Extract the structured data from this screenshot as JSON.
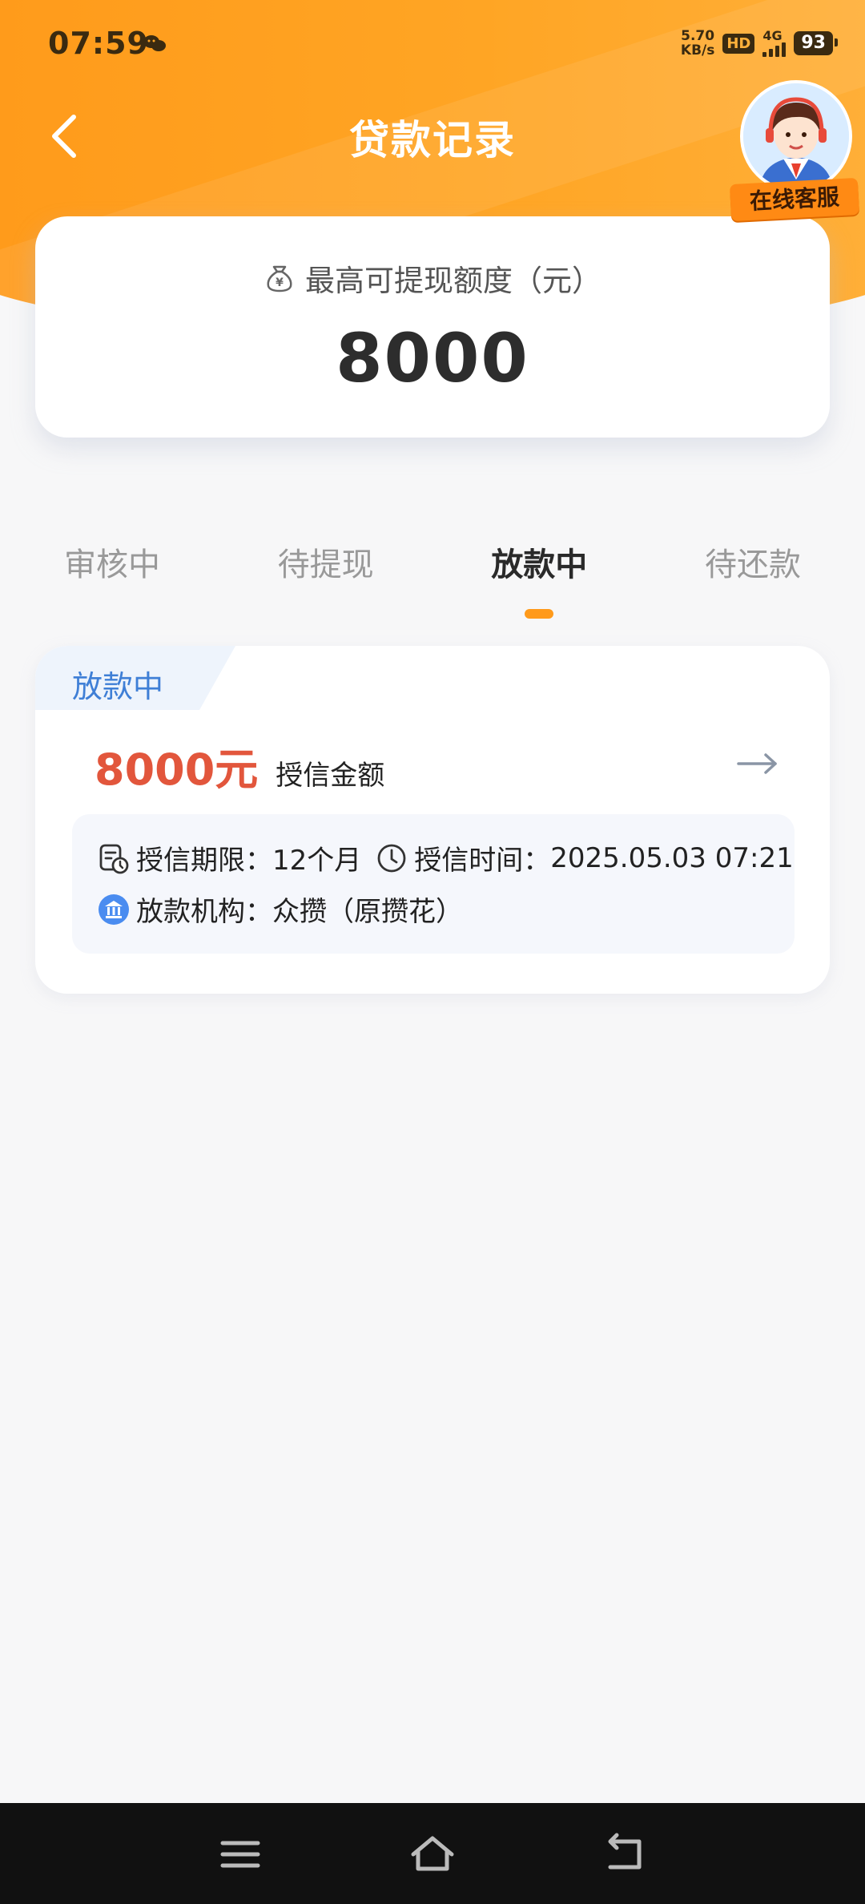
{
  "status_bar": {
    "time": "07:59",
    "net_speed_value": "5.70",
    "net_speed_unit": "KB/s",
    "hd": "HD",
    "network": "4G",
    "battery": "93"
  },
  "header": {
    "title": "贷款记录",
    "service_label": "在线客服"
  },
  "quota": {
    "label": "最高可提现额度（元）",
    "value": "8000"
  },
  "tabs": [
    {
      "label": "审核中",
      "active": false
    },
    {
      "label": "待提现",
      "active": false
    },
    {
      "label": "放款中",
      "active": true
    },
    {
      "label": "待还款",
      "active": false
    }
  ],
  "record": {
    "status": "放款中",
    "amount": "8000元",
    "amount_label": "授信金额",
    "term_label": "授信期限：",
    "term_value": "12个月",
    "time_label": "授信时间：",
    "time_value": "2025.05.03 07:21",
    "institution_label": "放款机构：",
    "institution_value": "众攒（原攒花）"
  },
  "colors": {
    "header_orange": "#ffa524",
    "accent_orange": "#ff9a1a",
    "amount_red": "#e2563c",
    "status_blue": "#3f7fd6"
  },
  "icons": {
    "back": "chevron-left-icon",
    "money_bag": "money-bag-icon",
    "arrow": "arrow-right-icon",
    "calendar": "calendar-clock-icon",
    "clock": "clock-icon",
    "bank": "bank-icon"
  }
}
